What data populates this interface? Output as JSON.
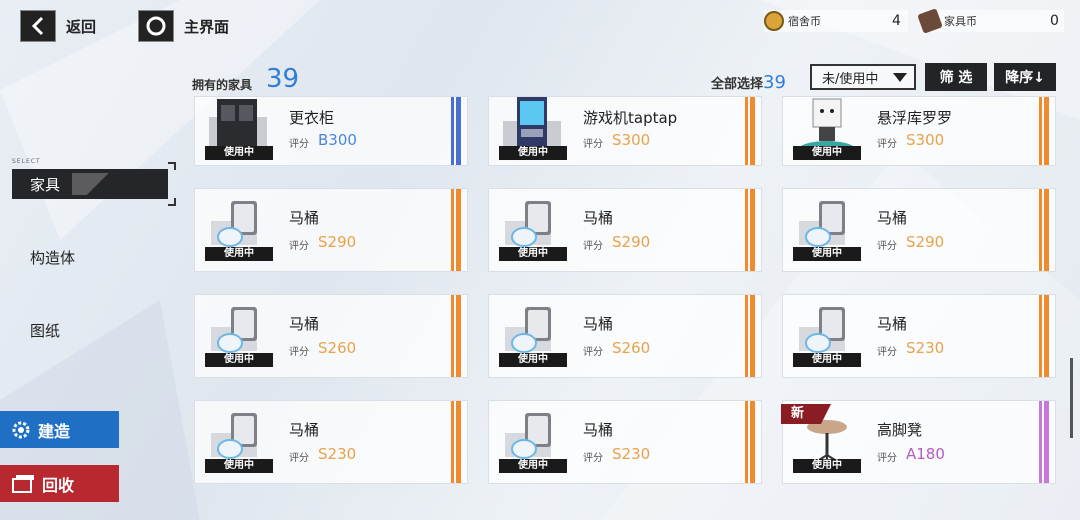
{
  "topbar": {
    "back_label": "返回",
    "home_label": "主界面",
    "dorm_coin": {
      "label": "宿舍币",
      "value": "4"
    },
    "furniture_coin": {
      "label": "家具币",
      "value": "0"
    }
  },
  "header": {
    "owned_label": "拥有的家具",
    "owned_count": "39",
    "select_all_label": "全部选择",
    "select_all_count": "39",
    "filter_dropdown_value": "未/使用中",
    "filter_button": "筛 选",
    "sort_button": "降序↓"
  },
  "sidebar": {
    "select_tag": "SELECT",
    "items": [
      {
        "label": "家具",
        "active": true
      },
      {
        "label": "构造体",
        "active": false
      },
      {
        "label": "图纸",
        "active": false
      }
    ],
    "build_button": "建造",
    "recycle_button": "回收"
  },
  "colors": {
    "accent_blue": "#2f7fd6",
    "stripe_blue": "#4a6fd0",
    "stripe_orange": "#f08a2a",
    "stripe_purple": "#c878d8",
    "score_b": "#4a86d8",
    "score_s": "#e9a24a",
    "score_a": "#b45bc8",
    "build_blue": "#1f6fc4",
    "recycle_red": "#b7282f"
  },
  "status_label": "使用中",
  "new_tag": "新",
  "score_label": "评分",
  "cards": [
    {
      "name": "更衣柜",
      "score": "B300",
      "grade": "B",
      "icon": "wardrobe-icon",
      "in_use": true,
      "is_new": false
    },
    {
      "name": "游戏机taptap",
      "score": "S300",
      "grade": "S",
      "icon": "arcade-machine-icon",
      "in_use": true,
      "is_new": false
    },
    {
      "name": "悬浮库罗罗",
      "score": "S300",
      "grade": "S",
      "icon": "floating-robot-icon",
      "in_use": true,
      "is_new": false
    },
    {
      "name": "马桶",
      "score": "S290",
      "grade": "S",
      "icon": "toilet-icon",
      "in_use": true,
      "is_new": false
    },
    {
      "name": "马桶",
      "score": "S290",
      "grade": "S",
      "icon": "toilet-icon",
      "in_use": true,
      "is_new": false
    },
    {
      "name": "马桶",
      "score": "S290",
      "grade": "S",
      "icon": "toilet-icon",
      "in_use": true,
      "is_new": false
    },
    {
      "name": "马桶",
      "score": "S260",
      "grade": "S",
      "icon": "toilet-icon",
      "in_use": true,
      "is_new": false
    },
    {
      "name": "马桶",
      "score": "S260",
      "grade": "S",
      "icon": "toilet-icon",
      "in_use": true,
      "is_new": false
    },
    {
      "name": "马桶",
      "score": "S230",
      "grade": "S",
      "icon": "toilet-icon",
      "in_use": true,
      "is_new": false
    },
    {
      "name": "马桶",
      "score": "S230",
      "grade": "S",
      "icon": "toilet-icon",
      "in_use": true,
      "is_new": false
    },
    {
      "name": "马桶",
      "score": "S230",
      "grade": "S",
      "icon": "toilet-icon",
      "in_use": true,
      "is_new": false
    },
    {
      "name": "高脚凳",
      "score": "A180",
      "grade": "A",
      "icon": "bar-stool-icon",
      "in_use": true,
      "is_new": true
    }
  ]
}
